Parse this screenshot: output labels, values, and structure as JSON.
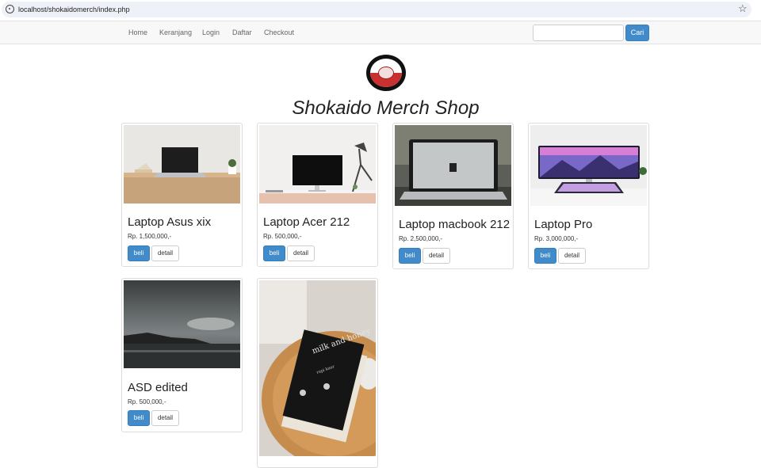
{
  "browser": {
    "url": "localhost/shokaidomerch/index.php",
    "info_icon": "info-circle-icon",
    "bookmark_icon": "star-outline-icon"
  },
  "navbar": {
    "items": [
      "Home",
      "Keranjang",
      "Login",
      "Daftar",
      "Checkout"
    ],
    "search_value": "",
    "search_button": "Cari",
    "accent_color": "#428bca"
  },
  "header": {
    "logo_icon": "shokaido-emblem-logo",
    "title": "Shokaido Merch Shop"
  },
  "products": [
    {
      "name": "Laptop Asus xix",
      "price": "Rp. 1,500,000,-",
      "buy_label": "beli",
      "detail_label": "detail"
    },
    {
      "name": "Laptop Acer 212",
      "price": "Rp. 500,000,-",
      "buy_label": "beli",
      "detail_label": "detail"
    },
    {
      "name": "Laptop macbook 212",
      "price": "Rp. 2,500,000,-",
      "buy_label": "beli",
      "detail_label": "detail"
    },
    {
      "name": "Laptop Pro",
      "price": "Rp. 3,000,000,-",
      "buy_label": "beli",
      "detail_label": "detail"
    },
    {
      "name": "ASD edited",
      "price": "Rp. 500,000,-",
      "buy_label": "beli",
      "detail_label": "detail"
    },
    {
      "name": "",
      "price": "",
      "buy_label": "",
      "detail_label": ""
    }
  ],
  "book_cover": {
    "title": "milk and honey",
    "author": "rupi kaur"
  }
}
